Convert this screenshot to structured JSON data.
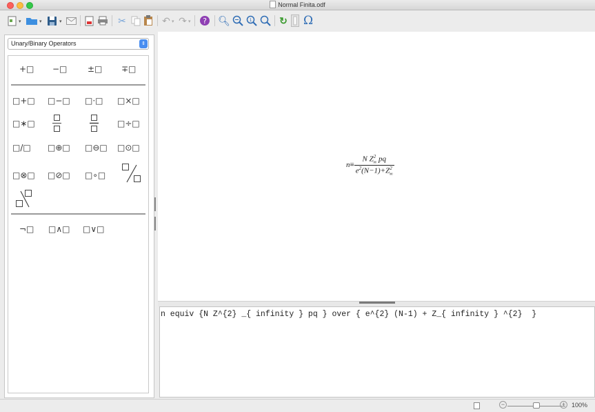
{
  "window": {
    "title": "Normal Finita.odf"
  },
  "toolbar": {
    "icons": [
      "new-icon",
      "open-folder-icon",
      "save-icon",
      "email-icon",
      "export-pdf-icon",
      "print-icon",
      "cut-icon",
      "copy-icon",
      "paste-icon",
      "undo-icon",
      "redo-icon",
      "help-icon",
      "zoom-in-icon",
      "zoom-out-icon",
      "zoom-100-icon",
      "zoom-fit-icon",
      "update-icon",
      "formula-cursor-icon",
      "symbols-icon"
    ]
  },
  "elements_panel": {
    "category": "Unary/Binary Operators",
    "unary": [
      "+□",
      "−□",
      "±□",
      "∓□"
    ],
    "binary_row1": [
      "□+□",
      "□−□",
      "□·□",
      "□×□"
    ],
    "binary_row2": [
      "□∗□",
      "□÷□"
    ],
    "binary_row3": [
      "□/□",
      "□⊕□",
      "□⊖□",
      "□⊙□"
    ],
    "binary_row4": [
      "□⊗□",
      "□⊘□",
      "□∘□"
    ],
    "logic": [
      "¬□",
      "□∧□",
      "□∨□"
    ]
  },
  "formula": {
    "lhs": "n",
    "rel": "≡",
    "num_a": "N Z",
    "num_sup": "2",
    "num_sub": "∞",
    "num_b": " pq",
    "den_a": "e",
    "den_sup": "2",
    "den_b": "(N−1)+Z",
    "den_sup2": "2",
    "den_sub2": "∞"
  },
  "command": {
    "text": "n equiv {N Z^{2} _{ infinity } pq } over { e^{2} (N-1) + Z_{ infinity } ^{2}  }"
  },
  "status": {
    "zoom": "100%",
    "zoom_level": 1.0
  }
}
